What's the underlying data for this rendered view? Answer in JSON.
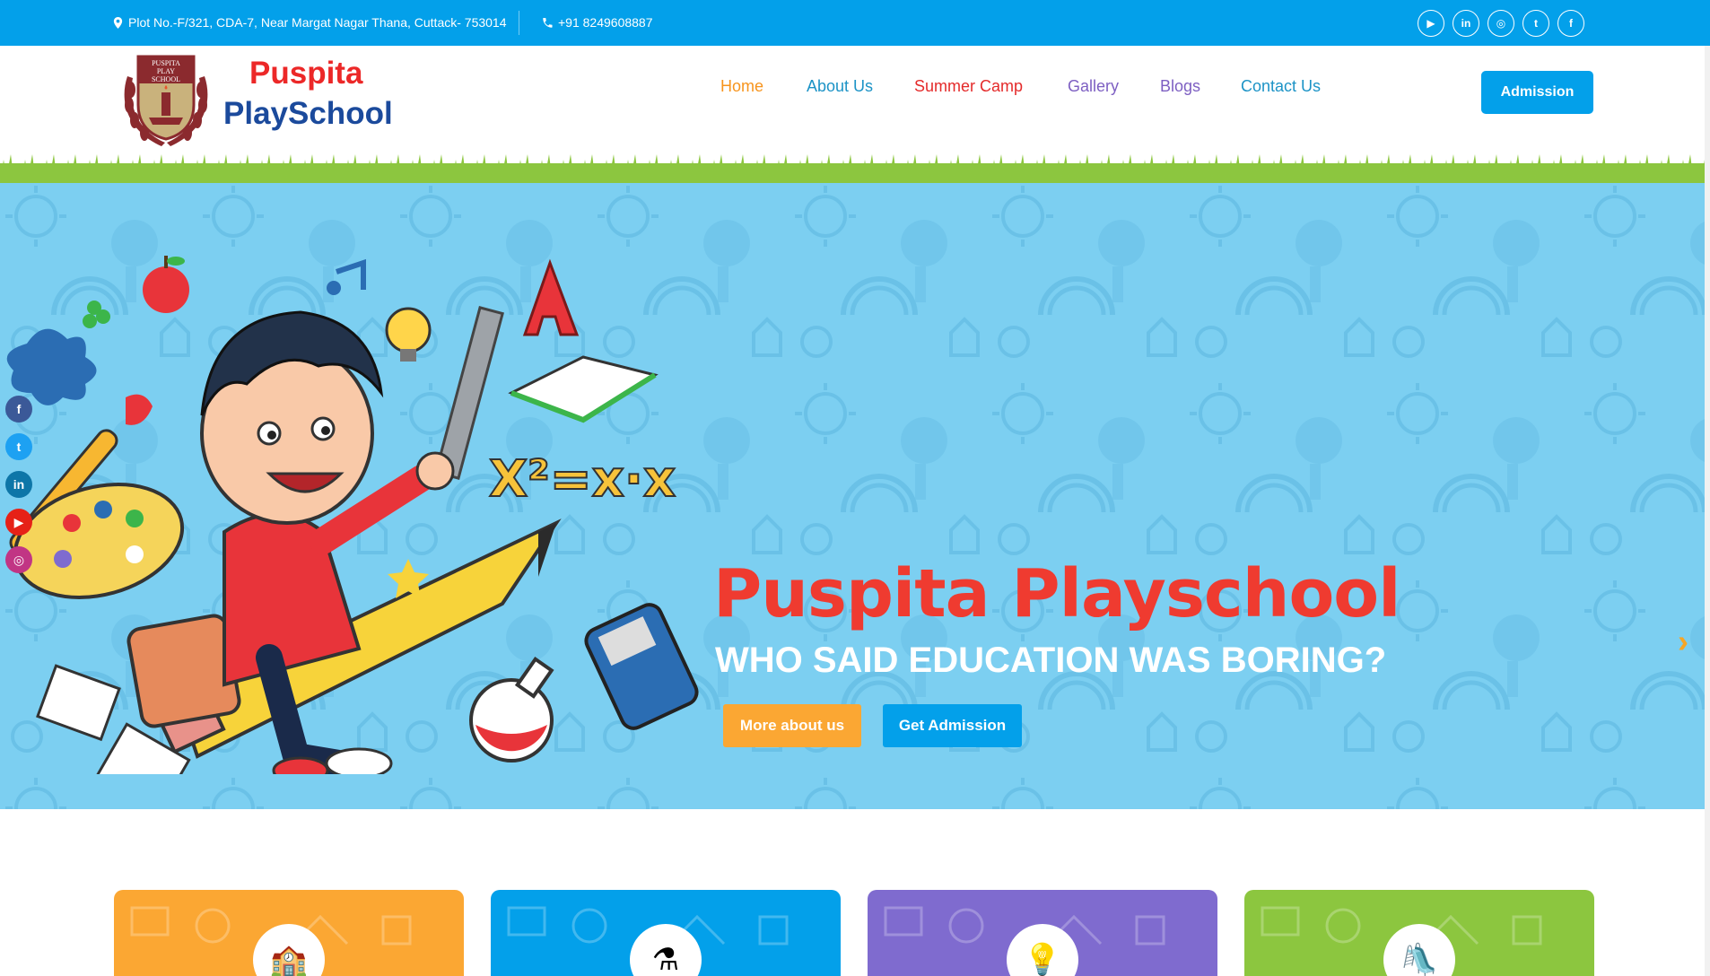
{
  "topbar": {
    "address": "Plot No.-F/321, CDA-7, Near Margat Nagar Thana, Cuttack- 753014",
    "phone": "+91 8249608887",
    "socials": [
      "youtube-icon",
      "linkedin-icon",
      "instagram-icon",
      "twitter-icon",
      "facebook-icon"
    ],
    "social_glyphs": [
      "▶",
      "in",
      "◎",
      "t",
      "f"
    ]
  },
  "logo": {
    "line1": "Puspita",
    "line2": "PlaySchool",
    "emblem_top": "PUSPITA",
    "emblem_mid": "PLAY",
    "emblem_bottom": "SCHOOL"
  },
  "nav": {
    "items": [
      {
        "label": "Home",
        "color": "#f7941d"
      },
      {
        "label": "About Us",
        "color": "#1c93c6"
      },
      {
        "label": "Summer Camp",
        "color": "#e42a2a"
      },
      {
        "label": "Gallery",
        "color": "#7d5fc2"
      },
      {
        "label": "Blogs",
        "color": "#7d5fc2"
      },
      {
        "label": "Contact Us",
        "color": "#1c93c6"
      }
    ],
    "admission_label": "Admission"
  },
  "hero": {
    "title": "Puspita Playschool",
    "subtitle": "WHO SAID EDUCATION WAS BORING?",
    "btn_more": "More about us",
    "btn_get": "Get Admission",
    "next_arrow": "›",
    "side_socials": [
      "facebook-icon",
      "twitter-icon",
      "linkedin-icon",
      "youtube-icon",
      "instagram-icon"
    ]
  },
  "cards": [
    {
      "color": "#fba733",
      "icon": "school-icon",
      "glyph": "🏫"
    },
    {
      "color": "#03a0ea",
      "icon": "flask-icon",
      "glyph": "⚗"
    },
    {
      "color": "#7f6bcf",
      "icon": "bulb-icon",
      "glyph": "💡"
    },
    {
      "color": "#8cc63f",
      "icon": "playground-icon",
      "glyph": "🛝"
    }
  ]
}
